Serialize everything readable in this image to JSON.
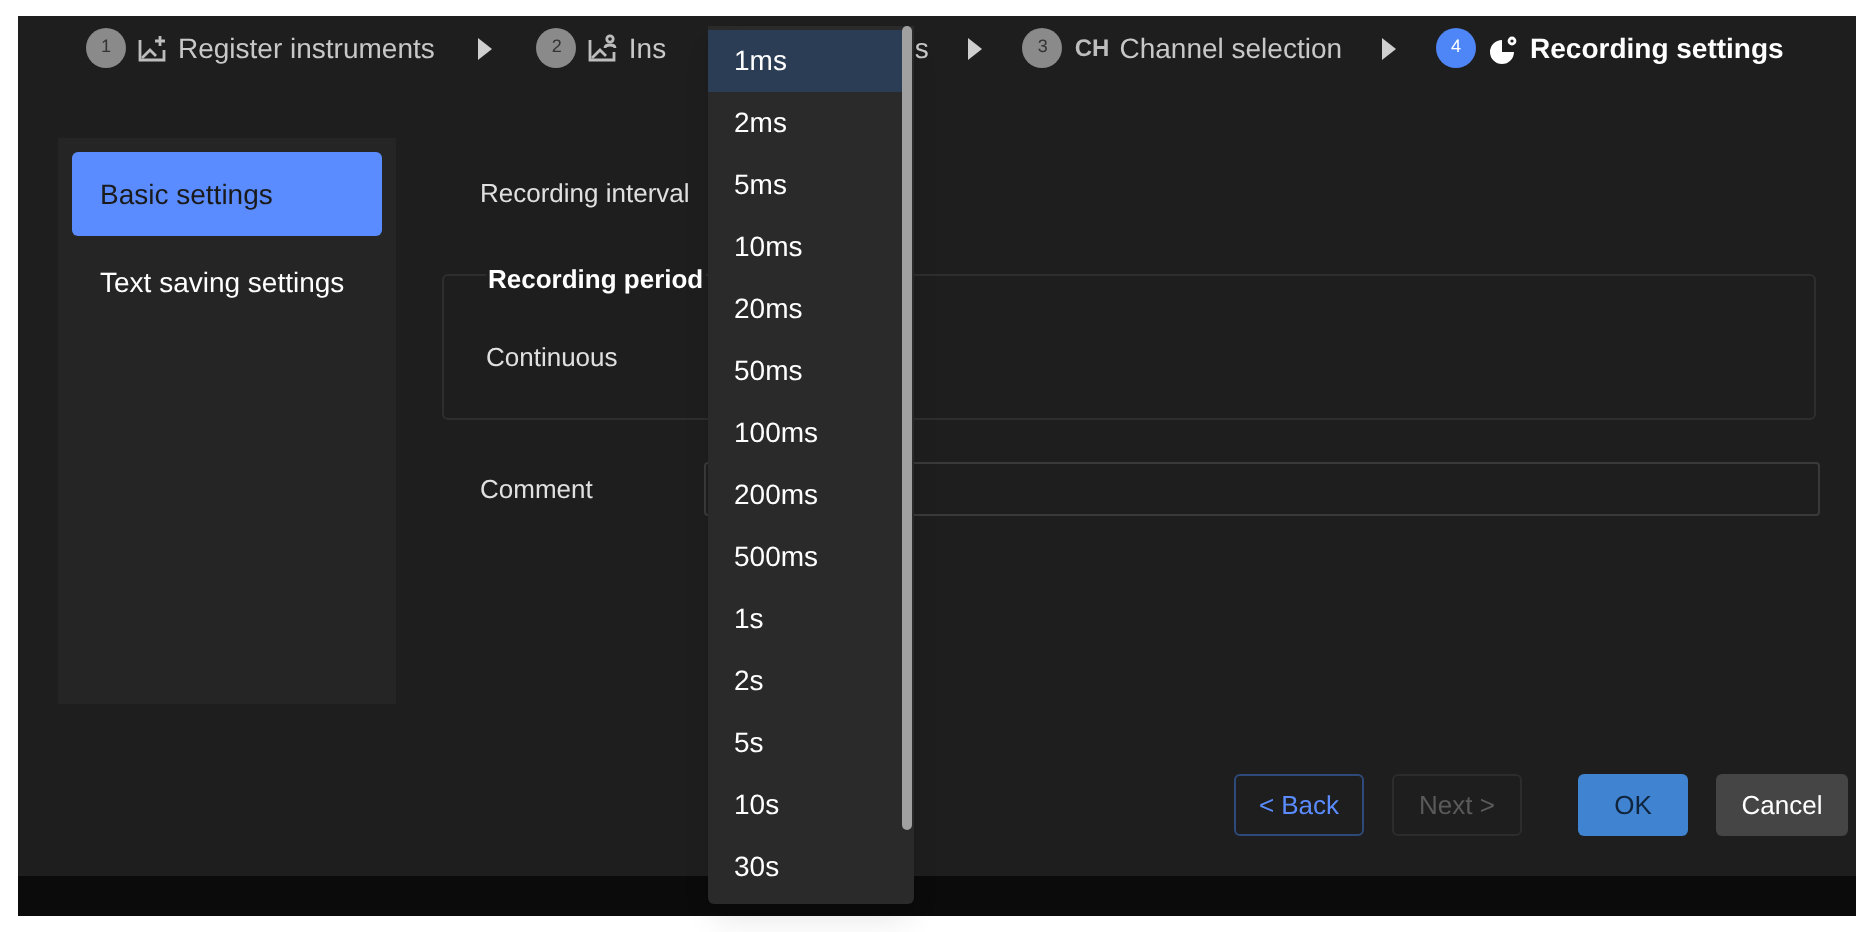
{
  "steps": [
    {
      "number": "1",
      "label": "Register instruments",
      "selected": false
    },
    {
      "number": "2",
      "label": "Ins",
      "tail": "s",
      "selected": false
    },
    {
      "number": "3",
      "label": "Channel selection",
      "icon_text": "CH",
      "selected": false
    },
    {
      "number": "4",
      "label": "Recording settings",
      "selected": true
    }
  ],
  "sidebar": {
    "items": [
      {
        "label": "Basic settings",
        "selected": true
      },
      {
        "label": "Text saving settings",
        "selected": false
      }
    ]
  },
  "form": {
    "recording_interval_label": "Recording interval",
    "recording_period": {
      "legend": "Recording period",
      "value": "Continuous"
    },
    "comment_label": "Comment"
  },
  "dropdown": {
    "options": [
      {
        "label": "1ms",
        "selected": true
      },
      {
        "label": "2ms",
        "selected": false
      },
      {
        "label": "5ms",
        "selected": false
      },
      {
        "label": "10ms",
        "selected": false
      },
      {
        "label": "20ms",
        "selected": false
      },
      {
        "label": "50ms",
        "selected": false
      },
      {
        "label": "100ms",
        "selected": false
      },
      {
        "label": "200ms",
        "selected": false
      },
      {
        "label": "500ms",
        "selected": false
      },
      {
        "label": "1s",
        "selected": false
      },
      {
        "label": "2s",
        "selected": false
      },
      {
        "label": "5s",
        "selected": false
      },
      {
        "label": "10s",
        "selected": false
      },
      {
        "label": "30s",
        "selected": false
      }
    ]
  },
  "buttons": [
    {
      "label": "< Back",
      "kind": "outline",
      "disabled": false
    },
    {
      "label": "Next >",
      "kind": "outline",
      "disabled": true
    },
    {
      "label": "OK",
      "kind": "primary",
      "disabled": false
    },
    {
      "label": "Cancel",
      "kind": "secondary",
      "disabled": false
    }
  ]
}
